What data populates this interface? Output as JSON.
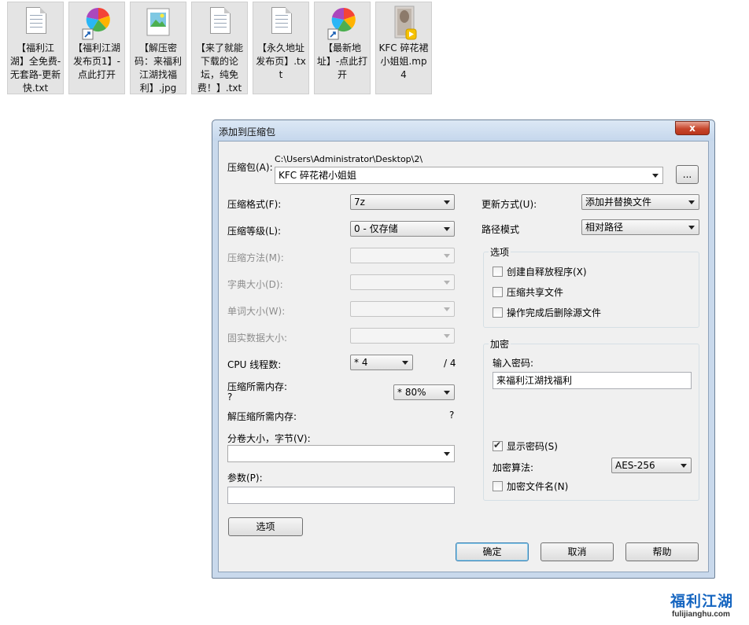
{
  "desktop": {
    "files": [
      {
        "name": "【福利江湖】全免费-无套路-更新快.txt",
        "icon": "text-file-icon"
      },
      {
        "name": "【福利江湖发布页1】-点此打开",
        "icon": "browser-shortcut-icon"
      },
      {
        "name": "【解压密码：来福利江湖找福利】.jpg",
        "icon": "image-file-icon"
      },
      {
        "name": "【来了就能下载的论坛，纯免费！】.txt",
        "icon": "text-file-icon"
      },
      {
        "name": "【永久地址发布页】.txt",
        "icon": "text-file-icon"
      },
      {
        "name": "【最新地址】-点此打开",
        "icon": "browser-shortcut-icon"
      },
      {
        "name": "KFC 碎花裙小姐姐.mp4",
        "icon": "video-file-icon"
      }
    ]
  },
  "dialog": {
    "title": "添加到压缩包",
    "close_label": "x",
    "archive": {
      "label": "压缩包(A):",
      "path": "C:\\Users\\Administrator\\Desktop\\2\\",
      "name": "KFC 碎花裙小姐姐",
      "browse_label": "..."
    },
    "left": {
      "format_label": "压缩格式(F):",
      "format_value": "7z",
      "level_label": "压缩等级(L):",
      "level_value": "0 - 仅存储",
      "method_label": "压缩方法(M):",
      "dict_label": "字典大小(D):",
      "word_label": "单词大小(W):",
      "solid_label": "固实数据大小:",
      "cpu_label": "CPU 线程数:",
      "cpu_value": "* 4",
      "cpu_max": "/ 4",
      "mem_label": "压缩所需内存:",
      "mem_question": "?",
      "mem_value": "* 80%",
      "dmem_label": "解压缩所需内存:",
      "dmem_value": "?",
      "split_label": "分卷大小，字节(V):",
      "params_label": "参数(P):",
      "options_button": "选项"
    },
    "right": {
      "update_label": "更新方式(U):",
      "update_value": "添加并替换文件",
      "path_label": "路径模式",
      "path_value": "相对路径",
      "options_group": "选项",
      "opt_sfx": "创建自释放程序(X)",
      "opt_shared": "压缩共享文件",
      "opt_delete": "操作完成后删除源文件",
      "enc_group": "加密",
      "password_label": "输入密码:",
      "password_value": "来福利江湖找福利",
      "show_password": "显示密码(S)",
      "method_label": "加密算法:",
      "method_value": "AES-256",
      "encrypt_names": "加密文件名(N)"
    },
    "buttons": {
      "ok": "确定",
      "cancel": "取消",
      "help": "帮助"
    }
  },
  "watermark": {
    "logo": "福利江湖",
    "url": "fulijianghu.com"
  }
}
